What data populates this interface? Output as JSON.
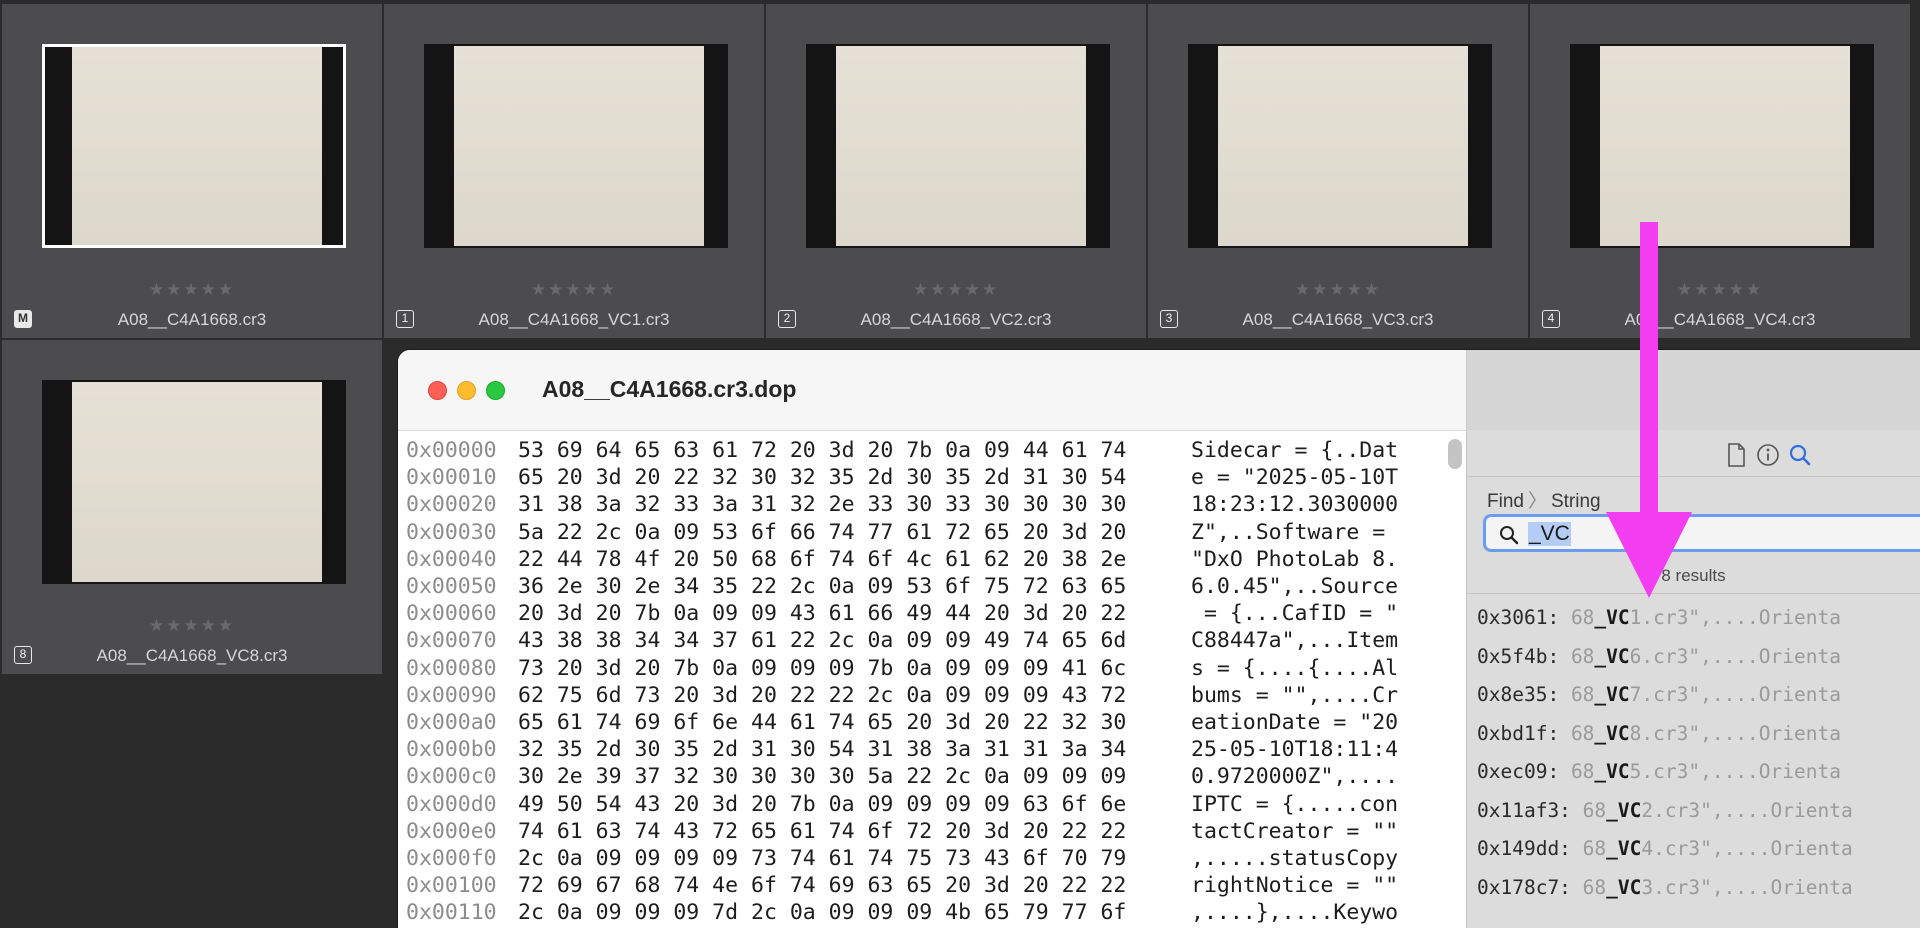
{
  "thumbnails": [
    {
      "badge": "M",
      "filename": "A08__C4A1668.cr3",
      "stars": "★★★★★",
      "selected": true
    },
    {
      "badge": "1",
      "filename": "A08__C4A1668_VC1.cr3",
      "stars": "★★★★★",
      "selected": false
    },
    {
      "badge": "2",
      "filename": "A08__C4A1668_VC2.cr3",
      "stars": "★★★★★",
      "selected": false
    },
    {
      "badge": "3",
      "filename": "A08__C4A1668_VC3.cr3",
      "stars": "★★★★★",
      "selected": false
    },
    {
      "badge": "4",
      "filename": "A08__C4A1668_VC4.cr3",
      "stars": "★★★★★",
      "selected": false
    },
    {
      "badge": "8",
      "filename": "A08__C4A1668_VC8.cr3",
      "stars": "★★★★★",
      "selected": false
    }
  ],
  "window": {
    "title": "A08__C4A1668.cr3.dop"
  },
  "hex_rows": [
    {
      "offset": "0x00000",
      "bytes": "53 69 64 65 63 61 72 20 3d 20 7b 0a 09 44 61 74",
      "ascii": "Sidecar = {..Dat"
    },
    {
      "offset": "0x00010",
      "bytes": "65 20 3d 20 22 32 30 32 35 2d 30 35 2d 31 30 54",
      "ascii": "e = \"2025-05-10T"
    },
    {
      "offset": "0x00020",
      "bytes": "31 38 3a 32 33 3a 31 32 2e 33 30 33 30 30 30 30",
      "ascii": "18:23:12.3030000"
    },
    {
      "offset": "0x00030",
      "bytes": "5a 22 2c 0a 09 53 6f 66 74 77 61 72 65 20 3d 20",
      "ascii": "Z\",..Software = "
    },
    {
      "offset": "0x00040",
      "bytes": "22 44 78 4f 20 50 68 6f 74 6f 4c 61 62 20 38 2e",
      "ascii": "\"DxO PhotoLab 8."
    },
    {
      "offset": "0x00050",
      "bytes": "36 2e 30 2e 34 35 22 2c 0a 09 53 6f 75 72 63 65",
      "ascii": "6.0.45\",..Source"
    },
    {
      "offset": "0x00060",
      "bytes": "20 3d 20 7b 0a 09 09 43 61 66 49 44 20 3d 20 22",
      "ascii": " = {...CafID = \""
    },
    {
      "offset": "0x00070",
      "bytes": "43 38 38 34 34 37 61 22 2c 0a 09 09 49 74 65 6d",
      "ascii": "C88447a\",...Item"
    },
    {
      "offset": "0x00080",
      "bytes": "73 20 3d 20 7b 0a 09 09 09 7b 0a 09 09 09 41 6c",
      "ascii": "s = {....{....Al"
    },
    {
      "offset": "0x00090",
      "bytes": "62 75 6d 73 20 3d 20 22 22 2c 0a 09 09 09 43 72",
      "ascii": "bums = \"\",....Cr"
    },
    {
      "offset": "0x000a0",
      "bytes": "65 61 74 69 6f 6e 44 61 74 65 20 3d 20 22 32 30",
      "ascii": "eationDate = \"20"
    },
    {
      "offset": "0x000b0",
      "bytes": "32 35 2d 30 35 2d 31 30 54 31 38 3a 31 31 3a 34",
      "ascii": "25-05-10T18:11:4"
    },
    {
      "offset": "0x000c0",
      "bytes": "30 2e 39 37 32 30 30 30 30 5a 22 2c 0a 09 09 09",
      "ascii": "0.9720000Z\",...."
    },
    {
      "offset": "0x000d0",
      "bytes": "49 50 54 43 20 3d 20 7b 0a 09 09 09 09 63 6f 6e",
      "ascii": "IPTC = {.....con"
    },
    {
      "offset": "0x000e0",
      "bytes": "74 61 63 74 43 72 65 61 74 6f 72 20 3d 20 22 22",
      "ascii": "tactCreator = \"\""
    },
    {
      "offset": "0x000f0",
      "bytes": "2c 0a 09 09 09 09 73 74 61 74 75 73 43 6f 70 79",
      "ascii": ",.....statusCopy"
    },
    {
      "offset": "0x00100",
      "bytes": "72 69 67 68 74 4e 6f 74 69 63 65 20 3d 20 22 22",
      "ascii": "rightNotice = \"\""
    },
    {
      "offset": "0x00110",
      "bytes": "2c 0a 09 09 09 7d 2c 0a 09 09 09 4b 65 79 77 6f",
      "ascii": ",....},....Keywo"
    }
  ],
  "sidebar": {
    "icons": [
      "document-icon",
      "info-icon",
      "search-icon"
    ],
    "breadcrumb": {
      "first": "Find",
      "second": "String"
    },
    "search_value": "_VC",
    "results_count": "8 results",
    "results": [
      {
        "addr": "0x3061:",
        "pre": "68",
        "hit": "_VC",
        "post": "1.cr3\",....Orienta"
      },
      {
        "addr": "0x5f4b:",
        "pre": "68",
        "hit": "_VC",
        "post": "6.cr3\",....Orienta"
      },
      {
        "addr": "0x8e35:",
        "pre": "68",
        "hit": "_VC",
        "post": "7.cr3\",....Orienta"
      },
      {
        "addr": "0xbd1f:",
        "pre": "68",
        "hit": "_VC",
        "post": "8.cr3\",....Orienta"
      },
      {
        "addr": "0xec09:",
        "pre": "68",
        "hit": "_VC",
        "post": "5.cr3\",....Orienta"
      },
      {
        "addr": "0x11af3:",
        "pre": "68",
        "hit": "_VC",
        "post": "2.cr3\",....Orienta"
      },
      {
        "addr": "0x149dd:",
        "pre": "68",
        "hit": "_VC",
        "post": "4.cr3\",....Orienta"
      },
      {
        "addr": "0x178c7:",
        "pre": "68",
        "hit": "_VC",
        "post": "3.cr3\",....Orienta"
      }
    ]
  },
  "colors": {
    "annotation_arrow": "#f23ef0",
    "search_focus": "#6c9bf2"
  }
}
